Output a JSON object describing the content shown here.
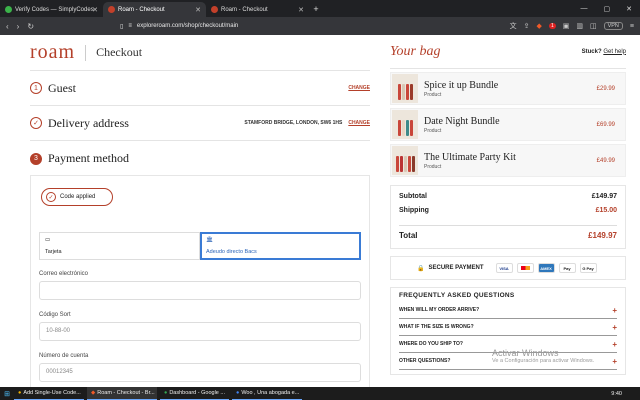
{
  "browser": {
    "tabs": [
      {
        "title": "Verify Codes — SimplyCodes",
        "icon": "check-icon",
        "color": "#3bb34a"
      },
      {
        "title": "Roam - Checkout",
        "icon": "roam-favicon",
        "color": "#c3402a"
      },
      {
        "title": "Roam - Checkout",
        "icon": "roam-favicon",
        "color": "#c3402a"
      }
    ],
    "url": "exploreroam.com/shop/checkout/main",
    "vpn_label": "VPN",
    "badge_count": "1"
  },
  "header": {
    "logo": "roam",
    "title": "Checkout"
  },
  "steps": [
    {
      "num": "1",
      "title": "Guest",
      "detail": "",
      "action": "CHANGE",
      "state": "done"
    },
    {
      "num": "✓",
      "title": "Delivery address",
      "detail": "STAMFORD BRIDGE, LONDON, SW6 1HS",
      "action": "CHANGE",
      "state": "done"
    },
    {
      "num": "3",
      "title": "Payment method",
      "detail": "",
      "action": "",
      "state": "active"
    }
  ],
  "payment": {
    "code_applied": "Code applied",
    "tabs": [
      {
        "label": "Tarjeta",
        "icon": "card-icon"
      },
      {
        "label": "Adeudo directo Bacs",
        "icon": "bank-icon"
      }
    ],
    "fields": [
      {
        "label": "Correo electrónico",
        "placeholder": ""
      },
      {
        "label": "Código Sort",
        "placeholder": "10-88-00"
      },
      {
        "label": "Número de cuenta",
        "placeholder": "00012345"
      }
    ]
  },
  "bag": {
    "title": "Your bag",
    "stuck_text": "Stuck?",
    "help_link": "Get help",
    "items": [
      {
        "name": "Spice it up Bundle",
        "sub": "Product",
        "price": "£29.99"
      },
      {
        "name": "Date Night Bundle",
        "sub": "Product",
        "price": "£69.99"
      },
      {
        "name": "The Ultimate Party Kit",
        "sub": "Product",
        "price": "£49.99"
      }
    ],
    "subtotal_label": "Subtotal",
    "subtotal": "£149.97",
    "shipping_label": "Shipping",
    "shipping": "£15.00",
    "total_label": "Total",
    "total": "£149.97",
    "secure_label": "SECURE PAYMENT",
    "cards": [
      "VISA",
      "MC",
      "AMEX",
      "Pay",
      "G Pay"
    ]
  },
  "faq": {
    "title": "FREQUENTLY ASKED QUESTIONS",
    "questions": [
      "WHEN WILL MY ORDER ARRIVE?",
      "WHAT IF THE SIZE IS WRONG?",
      "WHERE DO YOU SHIP TO?",
      "OTHER QUESTIONS?"
    ]
  },
  "watermark": {
    "title": "Activar Windows",
    "sub": "Ve a Configuración para activar Windows."
  },
  "taskbar": {
    "apps": [
      "Add Single-Use Code...",
      "Roam - Checkout - Br...",
      "Dashboard - Google ...",
      "Woo , Una abogada e..."
    ],
    "clock": "9:40"
  },
  "colors": {
    "accent": "#b4402a",
    "link_blue": "#2a63b8"
  }
}
